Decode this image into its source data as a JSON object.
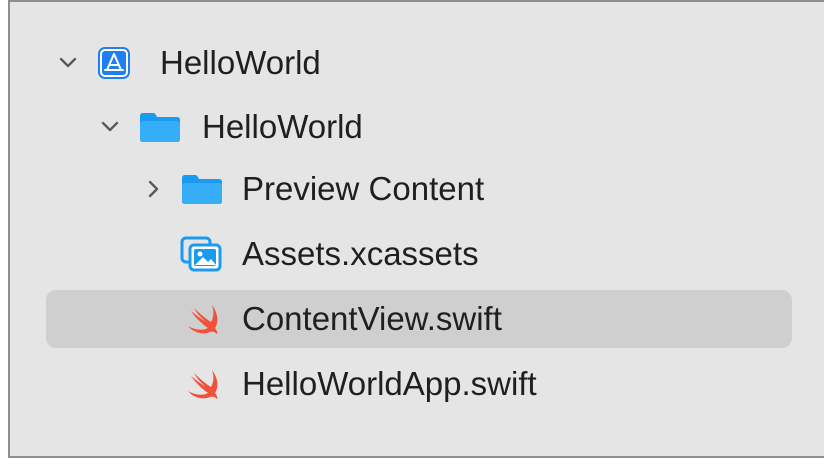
{
  "navigator": {
    "project": {
      "name": "HelloWorld",
      "icon": "xcode-project-icon",
      "expanded": true
    },
    "group": {
      "name": "HelloWorld",
      "icon": "folder-icon",
      "expanded": true
    },
    "items": [
      {
        "label": "Preview Content",
        "icon": "folder-icon",
        "expandable": true,
        "expanded": false
      },
      {
        "label": "Assets.xcassets",
        "icon": "asset-catalog-icon"
      },
      {
        "label": "ContentView.swift",
        "icon": "swift-file-icon",
        "selected": true
      },
      {
        "label": "HelloWorldApp.swift",
        "icon": "swift-file-icon"
      }
    ]
  },
  "colors": {
    "background": "#e5e5e5",
    "selection": "#cfcfcf",
    "folder_blue": "#1a9bf0",
    "project_blue": "#1f7ff2",
    "swift_orange": "#f05138",
    "text": "#1f1f1f"
  }
}
